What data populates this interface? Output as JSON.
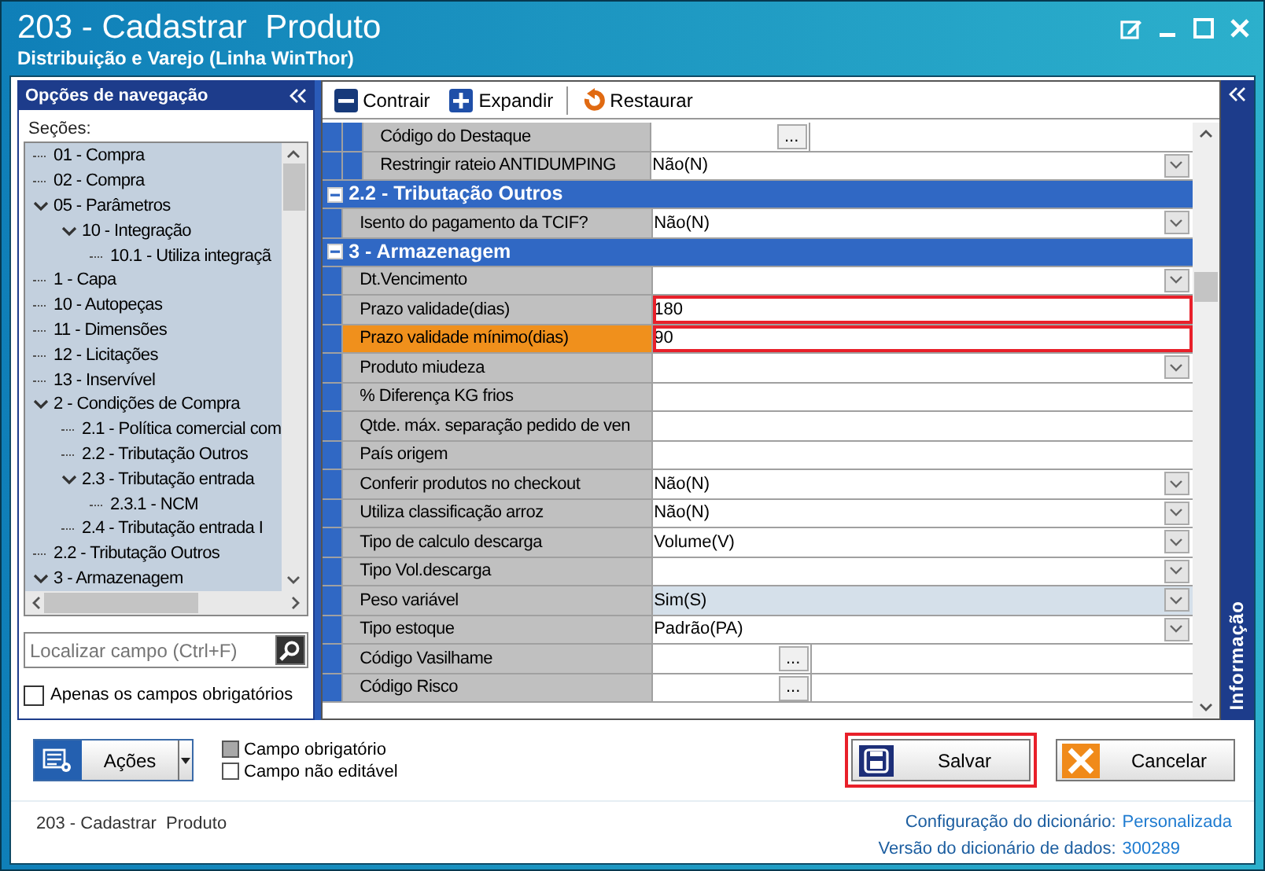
{
  "window": {
    "title": "203 - Cadastrar  Produto",
    "subtitle": "Distribuição e Varejo (Linha WinThor)"
  },
  "navigation": {
    "title": "Opções de navegação",
    "sections_label": "Seções:",
    "tree": [
      {
        "label": "01 - Compra"
      },
      {
        "label": "02 - Compra"
      },
      {
        "label": "05 - Parâmetros",
        "expanded": true,
        "children": [
          {
            "label": "10 - Integração",
            "expanded": true,
            "children": [
              {
                "label": "10.1 - Utiliza integraçã"
              }
            ]
          }
        ]
      },
      {
        "label": "1 - Capa"
      },
      {
        "label": "10 - Autopeças"
      },
      {
        "label": "11 - Dimensões"
      },
      {
        "label": "12 - Licitações"
      },
      {
        "label": "13 - Inservível"
      },
      {
        "label": "2 - Condições de Compra",
        "expanded": true,
        "children": [
          {
            "label": "2.1 - Política comercial com"
          },
          {
            "label": "2.2 - Tributação Outros"
          },
          {
            "label": "2.3 - Tributação entrada",
            "expanded": true,
            "children": [
              {
                "label": "2.3.1 - NCM"
              }
            ]
          },
          {
            "label": "2.4 - Tributação entrada I"
          }
        ]
      },
      {
        "label": "2.2 - Tributação Outros"
      },
      {
        "label": "3 - Armazenagem",
        "expanded": true
      }
    ],
    "search": {
      "placeholder": "Localizar campo (Ctrl+F)"
    },
    "required_only": {
      "label": "Apenas os campos obrigatórios",
      "checked": false
    }
  },
  "toolbar": [
    {
      "label": "Contrair",
      "kind": "collapse"
    },
    {
      "label": "Expandir",
      "kind": "expand"
    },
    {
      "label": "Restaurar",
      "kind": "restore"
    }
  ],
  "grid": {
    "sections": [
      {
        "sections": [
          {
            "rows": [
              {
                "label": "Código do Destaque",
                "kind": "ellipsis",
                "button": "...",
                "selected": false,
                "outlined": false,
                "highlighted": false
              },
              {
                "label": "Restringir rateio ANTIDUMPING",
                "value": "Não(N)",
                "kind": "dropdown",
                "selected": false,
                "outlined": false,
                "highlighted": false
              }
            ]
          }
        ]
      },
      {
        "title": "2.2 - Tributação Outros",
        "expanded": true,
        "rows": [
          {
            "label": "Isento do pagamento da TCIF?",
            "value": "Não(N)",
            "kind": "dropdown",
            "selected": false,
            "outlined": false,
            "highlighted": false
          }
        ]
      },
      {
        "title": "3 - Armazenagem",
        "expanded": true,
        "rows": [
          {
            "label": "Dt.Vencimento",
            "kind": "dropdown",
            "selected": false,
            "outlined": false,
            "highlighted": false
          },
          {
            "label": "Prazo validade(dias)",
            "value": "180",
            "kind": "text",
            "selected": false,
            "outlined": true,
            "highlighted": false
          },
          {
            "label": "Prazo validade mínimo(dias)",
            "value": "90",
            "kind": "text",
            "selected": true,
            "outlined": true,
            "highlighted": false
          },
          {
            "label": "Produto miudeza",
            "kind": "dropdown",
            "selected": false,
            "outlined": false,
            "highlighted": false
          },
          {
            "label": "% Diferença KG frios",
            "kind": "text",
            "selected": false,
            "outlined": false,
            "highlighted": false
          },
          {
            "label": "Qtde. máx. separação pedido de ven",
            "kind": "text",
            "selected": false,
            "outlined": false,
            "highlighted": false
          },
          {
            "label": "País origem",
            "kind": "text",
            "selected": false,
            "outlined": false,
            "highlighted": false
          },
          {
            "label": "Conferir produtos no checkout",
            "value": "Não(N)",
            "kind": "dropdown",
            "selected": false,
            "outlined": false,
            "highlighted": false
          },
          {
            "label": "Utiliza classificação arroz",
            "value": "Não(N)",
            "kind": "dropdown",
            "selected": false,
            "outlined": false,
            "highlighted": false
          },
          {
            "label": "Tipo de calculo descarga",
            "value": "Volume(V)",
            "kind": "dropdown",
            "selected": false,
            "outlined": false,
            "highlighted": false
          },
          {
            "label": "Tipo Vol.descarga",
            "kind": "dropdown",
            "selected": false,
            "outlined": false,
            "highlighted": false
          },
          {
            "label": "Peso variável",
            "value": "Sim(S)",
            "kind": "dropdown",
            "selected": false,
            "outlined": false,
            "highlighted": true
          },
          {
            "label": "Tipo estoque",
            "value": "Padrão(PA)",
            "kind": "dropdown",
            "selected": false,
            "outlined": false,
            "highlighted": false
          },
          {
            "label": "Código Vasilhame",
            "kind": "ellipsis",
            "button": "...",
            "selected": false,
            "outlined": false,
            "highlighted": false
          },
          {
            "label": "Código Risco",
            "kind": "ellipsis",
            "button": "...",
            "selected": false,
            "outlined": false,
            "highlighted": false
          }
        ]
      }
    ]
  },
  "info_panel": {
    "title": "Informação"
  },
  "actions": {
    "label": "Ações"
  },
  "legend": [
    {
      "label": "Campo obrigatório",
      "color": "#a8a8a8"
    },
    {
      "label": "Campo não editável",
      "color": "#ffffff"
    }
  ],
  "buttons": [
    {
      "label": "Salvar",
      "kind": "save",
      "outlined": true
    },
    {
      "label": "Cancelar",
      "kind": "cancel",
      "outlined": false
    }
  ],
  "status": {
    "screen": "203 - Cadastrar  Produto",
    "lines": [
      {
        "label": "Configuração do dicionário:",
        "value": "Personalizada"
      },
      {
        "label": "Versão do dicionário de dados:",
        "value": "300289"
      }
    ]
  }
}
